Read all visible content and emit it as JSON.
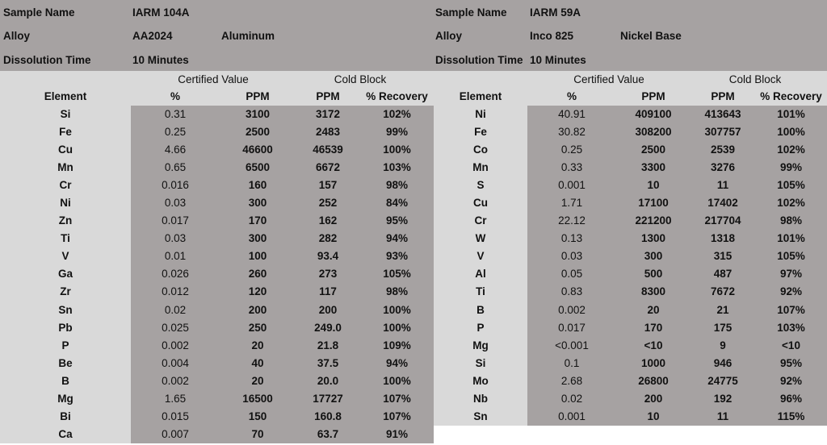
{
  "left": {
    "sample_label": "Sample Name",
    "sample_value": "IARM 104A",
    "alloy_label": "Alloy",
    "alloy_value": "AA2024",
    "alloy_type": "Aluminum",
    "dissolution_label": "Dissolution Time",
    "dissolution_value": "10 Minutes",
    "certified_label": "Certified Value",
    "cold_label": "Cold Block",
    "headers": [
      "Element",
      "%",
      "PPM",
      "PPM",
      "% Recovery"
    ],
    "rows": [
      [
        "Si",
        "0.31",
        "3100",
        "3172",
        "102%"
      ],
      [
        "Fe",
        "0.25",
        "2500",
        "2483",
        "99%"
      ],
      [
        "Cu",
        "4.66",
        "46600",
        "46539",
        "100%"
      ],
      [
        "Mn",
        "0.65",
        "6500",
        "6672",
        "103%"
      ],
      [
        "Cr",
        "0.016",
        "160",
        "157",
        "98%"
      ],
      [
        "Ni",
        "0.03",
        "300",
        "252",
        "84%"
      ],
      [
        "Zn",
        "0.017",
        "170",
        "162",
        "95%"
      ],
      [
        "Ti",
        "0.03",
        "300",
        "282",
        "94%"
      ],
      [
        "V",
        "0.01",
        "100",
        "93.4",
        "93%"
      ],
      [
        "Ga",
        "0.026",
        "260",
        "273",
        "105%"
      ],
      [
        "Zr",
        "0.012",
        "120",
        "117",
        "98%"
      ],
      [
        "Sn",
        "0.02",
        "200",
        "200",
        "100%"
      ],
      [
        "Pb",
        "0.025",
        "250",
        "249.0",
        "100%"
      ],
      [
        "P",
        "0.002",
        "20",
        "21.8",
        "109%"
      ],
      [
        "Be",
        "0.004",
        "40",
        "37.5",
        "94%"
      ],
      [
        "B",
        "0.002",
        "20",
        "20.0",
        "100%"
      ],
      [
        "Mg",
        "1.65",
        "16500",
        "17727",
        "107%"
      ],
      [
        "Bi",
        "0.015",
        "150",
        "160.8",
        "107%"
      ],
      [
        "Ca",
        "0.007",
        "70",
        "63.7",
        "91%"
      ]
    ]
  },
  "right": {
    "sample_label": "Sample Name",
    "sample_value": "IARM 59A",
    "alloy_label": "Alloy",
    "alloy_value": "Inco 825",
    "alloy_type": "Nickel Base",
    "dissolution_label": "Dissolution Time",
    "dissolution_value": "10 Minutes",
    "certified_label": "Certified Value",
    "cold_label": "Cold Block",
    "headers": [
      "Element",
      "%",
      "PPM",
      "PPM",
      "% Recovery"
    ],
    "rows": [
      [
        "Ni",
        "40.91",
        "409100",
        "413643",
        "101%"
      ],
      [
        "Fe",
        "30.82",
        "308200",
        "307757",
        "100%"
      ],
      [
        "Co",
        "0.25",
        "2500",
        "2539",
        "102%"
      ],
      [
        "Mn",
        "0.33",
        "3300",
        "3276",
        "99%"
      ],
      [
        "S",
        "0.001",
        "10",
        "11",
        "105%"
      ],
      [
        "Cu",
        "1.71",
        "17100",
        "17402",
        "102%"
      ],
      [
        "Cr",
        "22.12",
        "221200",
        "217704",
        "98%"
      ],
      [
        "W",
        "0.13",
        "1300",
        "1318",
        "101%"
      ],
      [
        "V",
        "0.03",
        "300",
        "315",
        "105%"
      ],
      [
        "Al",
        "0.05",
        "500",
        "487",
        "97%"
      ],
      [
        "Ti",
        "0.83",
        "8300",
        "7672",
        "92%"
      ],
      [
        "B",
        "0.002",
        "20",
        "21",
        "107%"
      ],
      [
        "P",
        "0.017",
        "170",
        "175",
        "103%"
      ],
      [
        "Mg",
        "<0.001",
        "<10",
        "9",
        "<10"
      ],
      [
        "Si",
        "0.1",
        "1000",
        "946",
        "95%"
      ],
      [
        "Mo",
        "2.68",
        "26800",
        "24775",
        "92%"
      ],
      [
        "Nb",
        "0.02",
        "200",
        "192",
        "96%"
      ],
      [
        "Sn",
        "0.001",
        "10",
        "11",
        "115%"
      ]
    ]
  }
}
